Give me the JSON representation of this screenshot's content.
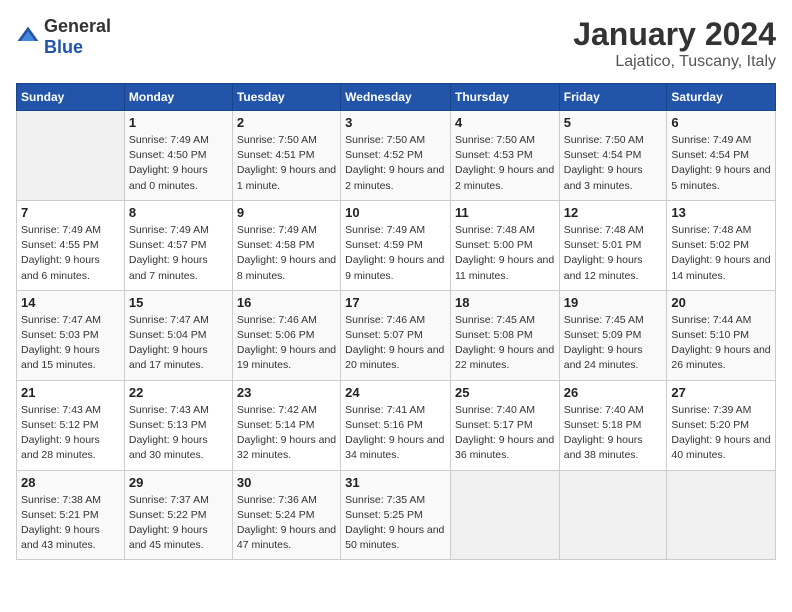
{
  "header": {
    "logo_general": "General",
    "logo_blue": "Blue",
    "month_year": "January 2024",
    "location": "Lajatico, Tuscany, Italy"
  },
  "weekdays": [
    "Sunday",
    "Monday",
    "Tuesday",
    "Wednesday",
    "Thursday",
    "Friday",
    "Saturday"
  ],
  "weeks": [
    [
      {
        "day": "",
        "sunrise": "",
        "sunset": "",
        "daylight": ""
      },
      {
        "day": "1",
        "sunrise": "Sunrise: 7:49 AM",
        "sunset": "Sunset: 4:50 PM",
        "daylight": "Daylight: 9 hours and 0 minutes."
      },
      {
        "day": "2",
        "sunrise": "Sunrise: 7:50 AM",
        "sunset": "Sunset: 4:51 PM",
        "daylight": "Daylight: 9 hours and 1 minute."
      },
      {
        "day": "3",
        "sunrise": "Sunrise: 7:50 AM",
        "sunset": "Sunset: 4:52 PM",
        "daylight": "Daylight: 9 hours and 2 minutes."
      },
      {
        "day": "4",
        "sunrise": "Sunrise: 7:50 AM",
        "sunset": "Sunset: 4:53 PM",
        "daylight": "Daylight: 9 hours and 2 minutes."
      },
      {
        "day": "5",
        "sunrise": "Sunrise: 7:50 AM",
        "sunset": "Sunset: 4:54 PM",
        "daylight": "Daylight: 9 hours and 3 minutes."
      },
      {
        "day": "6",
        "sunrise": "Sunrise: 7:49 AM",
        "sunset": "Sunset: 4:54 PM",
        "daylight": "Daylight: 9 hours and 5 minutes."
      }
    ],
    [
      {
        "day": "7",
        "sunrise": "Sunrise: 7:49 AM",
        "sunset": "Sunset: 4:55 PM",
        "daylight": "Daylight: 9 hours and 6 minutes."
      },
      {
        "day": "8",
        "sunrise": "Sunrise: 7:49 AM",
        "sunset": "Sunset: 4:57 PM",
        "daylight": "Daylight: 9 hours and 7 minutes."
      },
      {
        "day": "9",
        "sunrise": "Sunrise: 7:49 AM",
        "sunset": "Sunset: 4:58 PM",
        "daylight": "Daylight: 9 hours and 8 minutes."
      },
      {
        "day": "10",
        "sunrise": "Sunrise: 7:49 AM",
        "sunset": "Sunset: 4:59 PM",
        "daylight": "Daylight: 9 hours and 9 minutes."
      },
      {
        "day": "11",
        "sunrise": "Sunrise: 7:48 AM",
        "sunset": "Sunset: 5:00 PM",
        "daylight": "Daylight: 9 hours and 11 minutes."
      },
      {
        "day": "12",
        "sunrise": "Sunrise: 7:48 AM",
        "sunset": "Sunset: 5:01 PM",
        "daylight": "Daylight: 9 hours and 12 minutes."
      },
      {
        "day": "13",
        "sunrise": "Sunrise: 7:48 AM",
        "sunset": "Sunset: 5:02 PM",
        "daylight": "Daylight: 9 hours and 14 minutes."
      }
    ],
    [
      {
        "day": "14",
        "sunrise": "Sunrise: 7:47 AM",
        "sunset": "Sunset: 5:03 PM",
        "daylight": "Daylight: 9 hours and 15 minutes."
      },
      {
        "day": "15",
        "sunrise": "Sunrise: 7:47 AM",
        "sunset": "Sunset: 5:04 PM",
        "daylight": "Daylight: 9 hours and 17 minutes."
      },
      {
        "day": "16",
        "sunrise": "Sunrise: 7:46 AM",
        "sunset": "Sunset: 5:06 PM",
        "daylight": "Daylight: 9 hours and 19 minutes."
      },
      {
        "day": "17",
        "sunrise": "Sunrise: 7:46 AM",
        "sunset": "Sunset: 5:07 PM",
        "daylight": "Daylight: 9 hours and 20 minutes."
      },
      {
        "day": "18",
        "sunrise": "Sunrise: 7:45 AM",
        "sunset": "Sunset: 5:08 PM",
        "daylight": "Daylight: 9 hours and 22 minutes."
      },
      {
        "day": "19",
        "sunrise": "Sunrise: 7:45 AM",
        "sunset": "Sunset: 5:09 PM",
        "daylight": "Daylight: 9 hours and 24 minutes."
      },
      {
        "day": "20",
        "sunrise": "Sunrise: 7:44 AM",
        "sunset": "Sunset: 5:10 PM",
        "daylight": "Daylight: 9 hours and 26 minutes."
      }
    ],
    [
      {
        "day": "21",
        "sunrise": "Sunrise: 7:43 AM",
        "sunset": "Sunset: 5:12 PM",
        "daylight": "Daylight: 9 hours and 28 minutes."
      },
      {
        "day": "22",
        "sunrise": "Sunrise: 7:43 AM",
        "sunset": "Sunset: 5:13 PM",
        "daylight": "Daylight: 9 hours and 30 minutes."
      },
      {
        "day": "23",
        "sunrise": "Sunrise: 7:42 AM",
        "sunset": "Sunset: 5:14 PM",
        "daylight": "Daylight: 9 hours and 32 minutes."
      },
      {
        "day": "24",
        "sunrise": "Sunrise: 7:41 AM",
        "sunset": "Sunset: 5:16 PM",
        "daylight": "Daylight: 9 hours and 34 minutes."
      },
      {
        "day": "25",
        "sunrise": "Sunrise: 7:40 AM",
        "sunset": "Sunset: 5:17 PM",
        "daylight": "Daylight: 9 hours and 36 minutes."
      },
      {
        "day": "26",
        "sunrise": "Sunrise: 7:40 AM",
        "sunset": "Sunset: 5:18 PM",
        "daylight": "Daylight: 9 hours and 38 minutes."
      },
      {
        "day": "27",
        "sunrise": "Sunrise: 7:39 AM",
        "sunset": "Sunset: 5:20 PM",
        "daylight": "Daylight: 9 hours and 40 minutes."
      }
    ],
    [
      {
        "day": "28",
        "sunrise": "Sunrise: 7:38 AM",
        "sunset": "Sunset: 5:21 PM",
        "daylight": "Daylight: 9 hours and 43 minutes."
      },
      {
        "day": "29",
        "sunrise": "Sunrise: 7:37 AM",
        "sunset": "Sunset: 5:22 PM",
        "daylight": "Daylight: 9 hours and 45 minutes."
      },
      {
        "day": "30",
        "sunrise": "Sunrise: 7:36 AM",
        "sunset": "Sunset: 5:24 PM",
        "daylight": "Daylight: 9 hours and 47 minutes."
      },
      {
        "day": "31",
        "sunrise": "Sunrise: 7:35 AM",
        "sunset": "Sunset: 5:25 PM",
        "daylight": "Daylight: 9 hours and 50 minutes."
      },
      {
        "day": "",
        "sunrise": "",
        "sunset": "",
        "daylight": ""
      },
      {
        "day": "",
        "sunrise": "",
        "sunset": "",
        "daylight": ""
      },
      {
        "day": "",
        "sunrise": "",
        "sunset": "",
        "daylight": ""
      }
    ]
  ]
}
